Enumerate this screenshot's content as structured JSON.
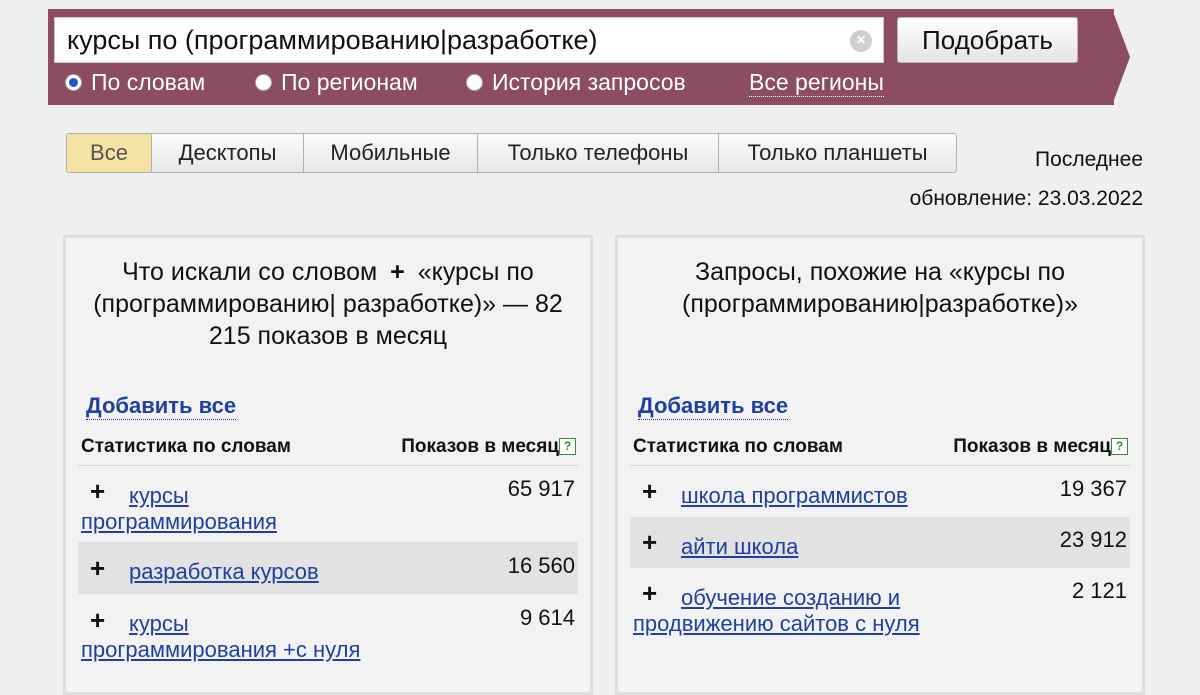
{
  "search": {
    "query": "курсы по (программированию|разработке)",
    "clear_icon": "×",
    "submit_label": "Подобрать",
    "modes": [
      {
        "label": "По словам",
        "checked": true
      },
      {
        "label": "По регионам",
        "checked": false
      },
      {
        "label": "История запросов",
        "checked": false
      }
    ],
    "regions_label": "Все регионы"
  },
  "device_tabs": [
    {
      "label": "Все",
      "active": true
    },
    {
      "label": "Десктопы",
      "active": false
    },
    {
      "label": "Мобильные",
      "active": false
    },
    {
      "label": "Только телефоны",
      "active": false
    },
    {
      "label": "Только планшеты",
      "active": false
    }
  ],
  "update": {
    "line1": "Последнее",
    "line2": "обновление: 23.03.2022"
  },
  "left_panel": {
    "heading_prefix": "Что искали со словом",
    "heading_plus": "+",
    "heading_rest": "«курсы по (программированию| разработке)» — 82 215 показов в месяц",
    "add_all": "Добавить все",
    "col_words": "Статистика по словам",
    "col_count": "Показов в месяц",
    "help": "?",
    "rows": [
      {
        "plus": "+",
        "phrase": "курсы программирования",
        "count": "65 917"
      },
      {
        "plus": "+",
        "phrase": "разработка курсов",
        "count": "16 560"
      },
      {
        "plus": "+",
        "phrase": "курсы программирования +с нуля",
        "count": "9 614"
      }
    ]
  },
  "right_panel": {
    "heading": "Запросы, похожие на «курсы по (программированию|разработке)»",
    "add_all": "Добавить все",
    "col_words": "Статистика по словам",
    "col_count": "Показов в месяц",
    "help": "?",
    "rows": [
      {
        "plus": "+",
        "phrase": "школа программистов",
        "count": "19 367"
      },
      {
        "plus": "+",
        "phrase": "айти школа",
        "count": "23 912"
      },
      {
        "plus": "+",
        "phrase": "обучение созданию и продвижению сайтов с нуля",
        "count": "2 121"
      }
    ]
  }
}
